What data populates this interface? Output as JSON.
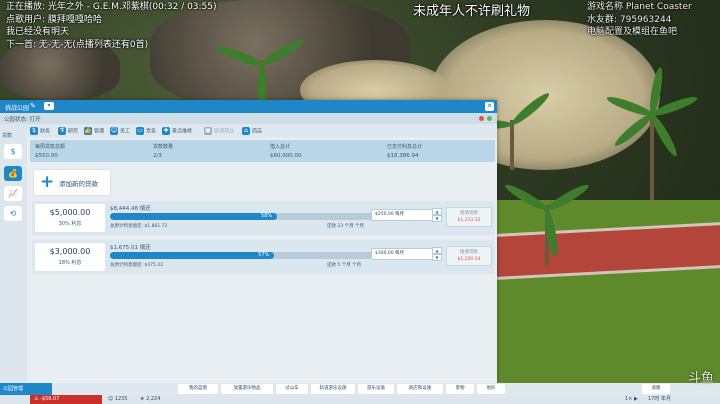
{
  "overlay": {
    "line1": "正在播放: 光年之外 - G.E.M.邓紫棋(00:32 / 03:55)",
    "line2": "点歌用户: 膜拜嘎嘎哈哈",
    "line3": "我已经没有明天",
    "line4": "下一首: 无-无-无(点播列表还有0首)",
    "center": "未成年人不许刷礼物",
    "right1": "游戏名称 Planet Coaster",
    "right2": "水友群: 795963244",
    "right3": "电脑配置及模组在鱼吧"
  },
  "panel": {
    "title": "挑战公园",
    "status": "公园状态: 打开",
    "tabs": [
      "财务",
      "研究",
      "管理",
      "员工",
      "票务",
      "景点维修",
      "管理营业",
      "商店"
    ],
    "sidebar_label": "贷款",
    "stats": [
      {
        "label": "每周贷款总额",
        "value": "$550.00"
      },
      {
        "label": "贷款数量",
        "value": "2/3"
      },
      {
        "label": "借入总计",
        "value": "$60,000.00"
      },
      {
        "label": "已支付利息总计",
        "value": "$18,386.94"
      }
    ],
    "add_loan": "添加新的贷款",
    "loans": [
      {
        "amount": "$5,000.00",
        "rate": "30% 利息",
        "balance": "$8,444.48 偿还",
        "progress": 58,
        "progress_label": "58%",
        "original": "总原计利息偿还: $1,861.72",
        "remaining": "还款 23 个月 个月",
        "payment": "$250.00 每月",
        "repay_label": "偿清贷款",
        "repay_value": "$1,213.32"
      },
      {
        "amount": "$3,000.00",
        "rate": "18% 利息",
        "balance": "$1,675.01 偿还",
        "progress": 57,
        "progress_label": "57%",
        "original": "总原计利息偿还: $475.22",
        "remaining": "还款 5 个月 个月",
        "payment": "$300.00 每月",
        "repay_label": "偿清贷款",
        "repay_value": "$1,200.04"
      }
    ]
  },
  "bottombar": {
    "left": "公园管理",
    "items": [
      "我的蓝图",
      "放置游乐物品",
      "过山车",
      "轨道游乐设施",
      "游乐设施",
      "商店和设施",
      "景物",
      "地形",
      "道路"
    ]
  },
  "statusline": {
    "money": "-$56.07",
    "guests": "1235",
    "rating": "2,224",
    "speed": "1× ▶",
    "time": "17时 年月"
  },
  "watermark": "斗鱼"
}
